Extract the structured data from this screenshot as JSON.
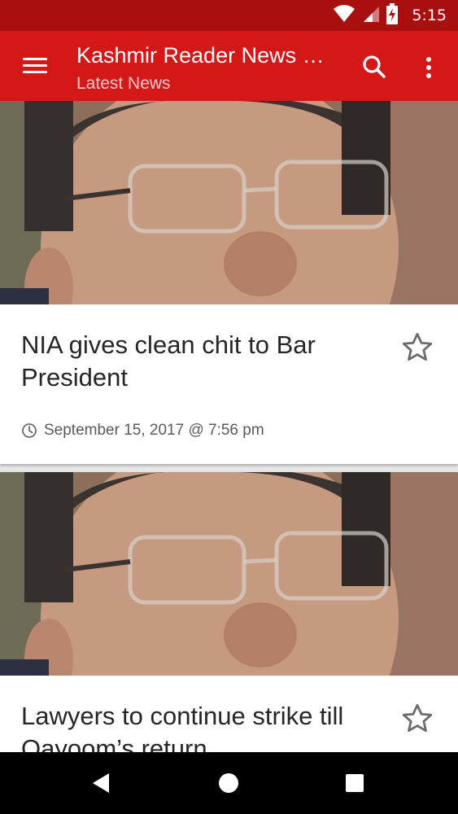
{
  "status_bar": {
    "time": "5:15",
    "icons": [
      "wifi-icon",
      "cellular-signal-icon",
      "battery-charging-icon"
    ]
  },
  "app_bar": {
    "title": "Kashmir Reader News & Magazine",
    "subtitle": "Latest News",
    "icons": [
      "menu-icon",
      "search-icon",
      "more-vert-icon"
    ],
    "color": "#d41717",
    "status_color": "#a90f0f"
  },
  "articles": [
    {
      "title": "NIA gives clean chit to Bar President",
      "date": "September 15, 2017 @ 7:56 pm",
      "bookmark_icon": "star-outline-icon"
    },
    {
      "title": "Lawyers to continue strike till Qayoom’s return",
      "bookmark_icon": "star-outline-icon"
    }
  ],
  "nav_bar": {
    "icons": [
      "back-icon",
      "home-icon",
      "recents-icon"
    ]
  }
}
